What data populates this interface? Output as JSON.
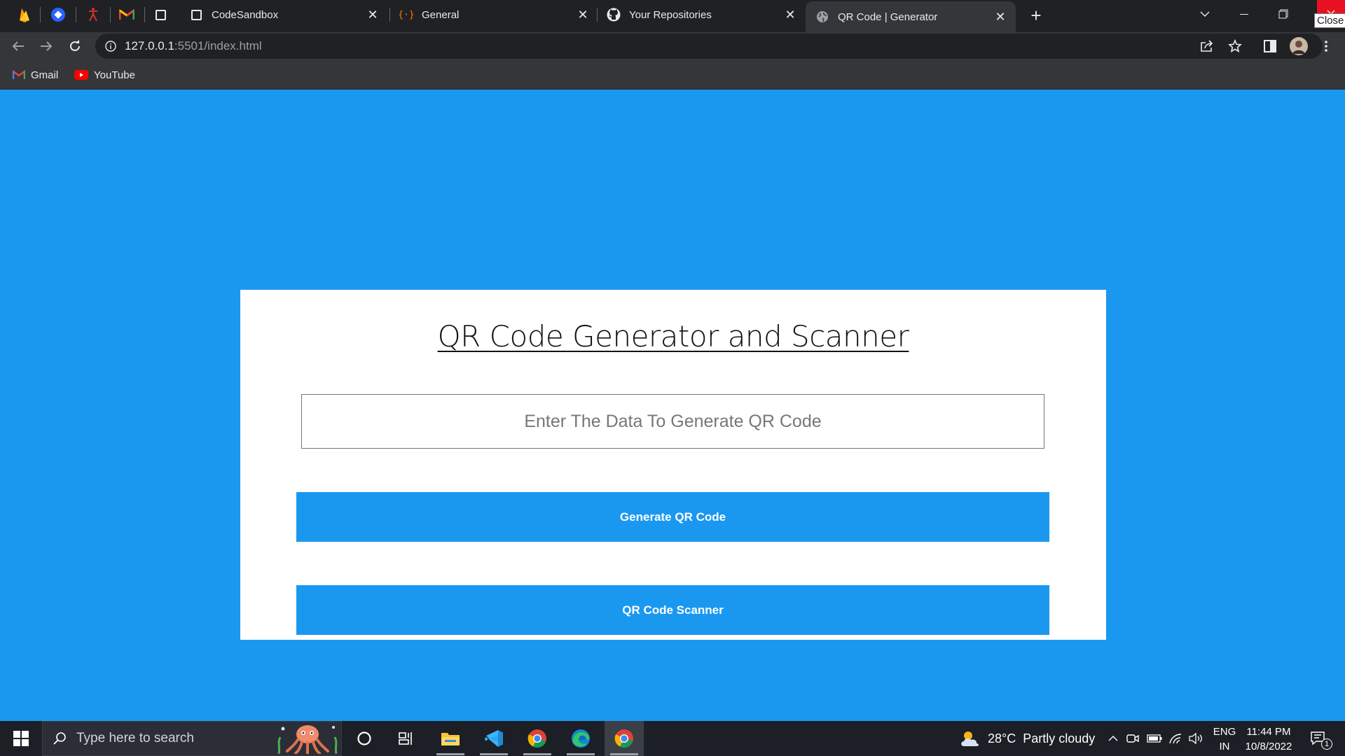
{
  "browser": {
    "pinned_tabs": [
      {
        "icon": "firebase-icon"
      },
      {
        "icon": "app-logo-icon"
      },
      {
        "icon": "figure-icon"
      },
      {
        "icon": "gmail-icon"
      }
    ],
    "tabs": [
      {
        "title": "CodeSandbox",
        "icon": "codesandbox-icon",
        "active": false
      },
      {
        "title": "General",
        "icon": "braces-icon",
        "active": false
      },
      {
        "title": "Your Repositories",
        "icon": "github-icon",
        "active": false
      },
      {
        "title": "QR Code | Generator",
        "icon": "globe-icon",
        "active": true
      }
    ],
    "tooltip": "Close",
    "url_host": "127.0.0.1",
    "url_rest": ":5501/index.html",
    "bookmarks": [
      {
        "label": "Gmail",
        "icon": "gmail-icon"
      },
      {
        "label": "YouTube",
        "icon": "youtube-icon"
      }
    ]
  },
  "page": {
    "title": "QR Code Generator and Scanner",
    "input_placeholder": "Enter The Data To Generate QR Code",
    "input_value": "",
    "generate_label": "Generate QR Code",
    "scanner_label": "QR Code Scanner",
    "accent_color": "#1a98f0"
  },
  "taskbar": {
    "search_placeholder": "Type here to search",
    "weather_temp": "28°C",
    "weather_text": "Partly cloudy",
    "lang_line1": "ENG",
    "lang_line2": "IN",
    "time": "11:44 PM",
    "date": "10/8/2022",
    "notification_count": "1"
  }
}
